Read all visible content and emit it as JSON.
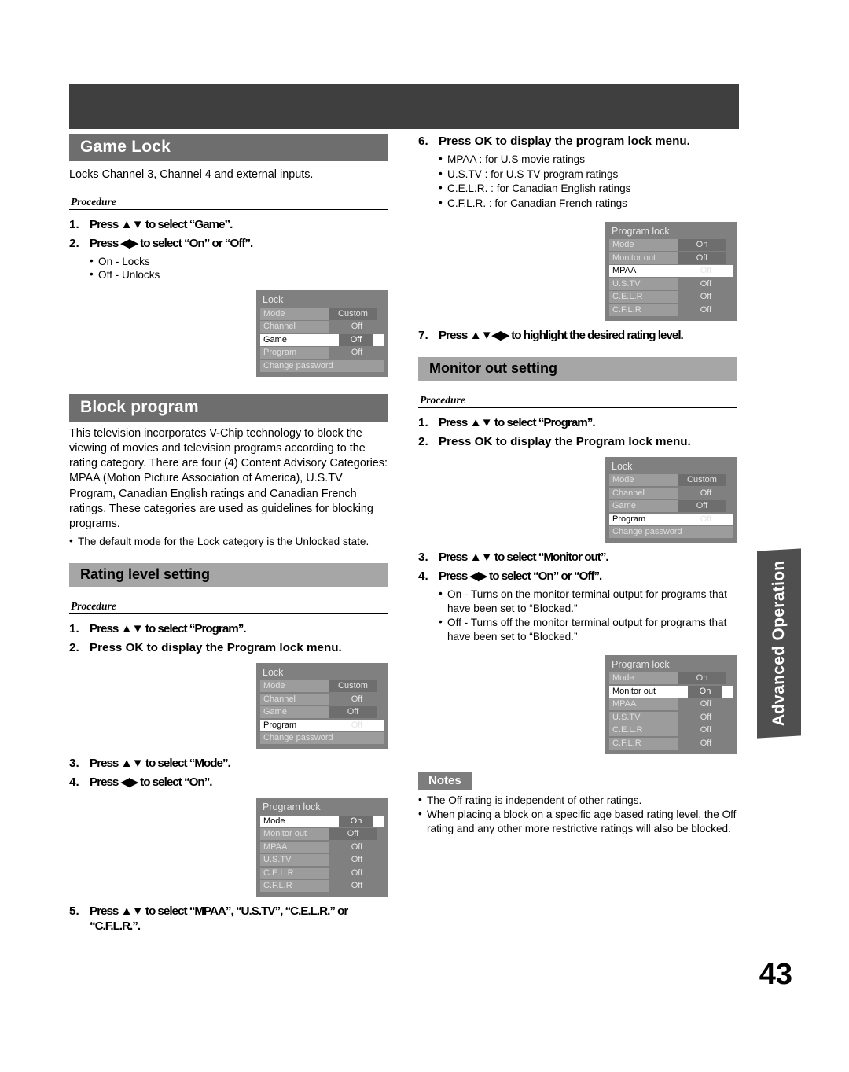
{
  "page": {
    "number": "43",
    "side_tab": "Advanced Operation"
  },
  "game_lock": {
    "heading": "Game Lock",
    "intro": "Locks Channel 3, Channel 4 and external inputs.",
    "procedure_label": "Procedure",
    "steps": [
      {
        "num": "1.",
        "text": "Press ▲▼ to select “Game”."
      },
      {
        "num": "2.",
        "text": "Press ◀▶ to select “On” or “Off”."
      }
    ],
    "bullets": [
      "On - Locks",
      "Off - Unlocks"
    ],
    "osd": {
      "title": "Lock",
      "rows": [
        {
          "label": "Mode",
          "value": "Custom",
          "boxed": true,
          "selected": false
        },
        {
          "label": "Channel",
          "value": "Off",
          "boxed": false,
          "selected": false
        },
        {
          "label": "Game",
          "value": "Off",
          "boxed": true,
          "selected": true
        },
        {
          "label": "Program",
          "value": "Off",
          "boxed": false,
          "selected": false
        },
        {
          "label": "Change password",
          "value": "",
          "boxed": false,
          "selected": false,
          "full": true
        }
      ]
    }
  },
  "block_program": {
    "heading": "Block program",
    "body": "This television incorporates V-Chip technology to block the viewing of movies and television programs according to the rating category. There are four (4) Content Advisory Categories: MPAA (Motion Picture Association of America), U.S.TV Program, Canadian English ratings and Canadian French ratings. These categories are used as guidelines for blocking programs.",
    "bullets": [
      "The default mode for the Lock category is the Unlocked state."
    ]
  },
  "rating_level": {
    "heading": "Rating level setting",
    "procedure_label": "Procedure",
    "steps_a": [
      {
        "num": "1.",
        "text": "Press ▲▼ to select “Program”."
      },
      {
        "num": "2.",
        "text": "Press OK to display the Program lock menu."
      }
    ],
    "osd_lock": {
      "title": "Lock",
      "rows": [
        {
          "label": "Mode",
          "value": "Custom",
          "boxed": true,
          "selected": false
        },
        {
          "label": "Channel",
          "value": "Off",
          "boxed": false,
          "selected": false
        },
        {
          "label": "Game",
          "value": "Off",
          "boxed": true,
          "selected": false
        },
        {
          "label": "Program",
          "value": "Off",
          "boxed": false,
          "selected": true
        },
        {
          "label": "Change password",
          "value": "",
          "boxed": false,
          "selected": false,
          "full": true
        }
      ]
    },
    "steps_b": [
      {
        "num": "3.",
        "text": "Press ▲▼ to select “Mode”."
      },
      {
        "num": "4.",
        "text": "Press ◀▶ to select “On”."
      }
    ],
    "osd_program_lock": {
      "title": "Program lock",
      "rows": [
        {
          "label": "Mode",
          "value": "On",
          "boxed": true,
          "selected": true
        },
        {
          "label": "Monitor out",
          "value": "Off",
          "boxed": true,
          "selected": false
        },
        {
          "label": "MPAA",
          "value": "Off",
          "boxed": false,
          "selected": false
        },
        {
          "label": "U.S.TV",
          "value": "Off",
          "boxed": false,
          "selected": false
        },
        {
          "label": "C.E.L.R",
          "value": "Off",
          "boxed": false,
          "selected": false
        },
        {
          "label": "C.F.L.R",
          "value": "Off",
          "boxed": false,
          "selected": false
        }
      ]
    },
    "steps_c": [
      {
        "num": "5.",
        "text": "Press ▲▼ to select “MPAA”, “U.S.TV”, “C.E.L.R.” or “C.F.L.R.”."
      }
    ],
    "steps_d": [
      {
        "num": "6.",
        "text": "Press OK to display the program lock menu."
      }
    ],
    "step6_bullets": [
      "MPAA : for U.S movie ratings",
      "U.S.TV : for U.S TV program ratings",
      "C.E.L.R. : for Canadian English ratings",
      "C.F.L.R. : for Canadian French ratings"
    ],
    "osd_program_lock_mpaa": {
      "title": "Program lock",
      "rows": [
        {
          "label": "Mode",
          "value": "On",
          "boxed": true,
          "selected": false
        },
        {
          "label": "Monitor out",
          "value": "Off",
          "boxed": true,
          "selected": false
        },
        {
          "label": "MPAA",
          "value": "Off",
          "boxed": false,
          "selected": true,
          "novalueframe": true
        },
        {
          "label": "U.S.TV",
          "value": "Off",
          "boxed": false,
          "selected": false
        },
        {
          "label": "C.E.L.R",
          "value": "Off",
          "boxed": false,
          "selected": false
        },
        {
          "label": "C.F.L.R",
          "value": "Off",
          "boxed": false,
          "selected": false
        }
      ]
    },
    "steps_e": [
      {
        "num": "7.",
        "text": "Press ▲▼◀▶ to highlight the desired rating level."
      }
    ]
  },
  "monitor_out": {
    "heading": "Monitor out setting",
    "procedure_label": "Procedure",
    "steps_a": [
      {
        "num": "1.",
        "text": "Press ▲▼ to select “Program”."
      },
      {
        "num": "2.",
        "text": "Press OK to display the Program lock menu."
      }
    ],
    "osd_lock": {
      "title": "Lock",
      "rows": [
        {
          "label": "Mode",
          "value": "Custom",
          "boxed": true,
          "selected": false
        },
        {
          "label": "Channel",
          "value": "Off",
          "boxed": false,
          "selected": false
        },
        {
          "label": "Game",
          "value": "Off",
          "boxed": true,
          "selected": false
        },
        {
          "label": "Program",
          "value": "Off",
          "boxed": false,
          "selected": true
        },
        {
          "label": "Change password",
          "value": "",
          "boxed": false,
          "selected": false,
          "full": true
        }
      ]
    },
    "steps_b": [
      {
        "num": "3.",
        "text": "Press ▲▼ to select “Monitor out”."
      },
      {
        "num": "4.",
        "text": "Press ◀▶ to select “On” or “Off”."
      }
    ],
    "bullets": [
      "On - Turns on the monitor terminal output for programs that have been set to “Blocked.”",
      "Off - Turns off the monitor terminal output for programs that have been set to “Blocked.”"
    ],
    "osd_program_lock": {
      "title": "Program lock",
      "rows": [
        {
          "label": "Mode",
          "value": "On",
          "boxed": true,
          "selected": false
        },
        {
          "label": "Monitor out",
          "value": "On",
          "boxed": true,
          "selected": true
        },
        {
          "label": "MPAA",
          "value": "Off",
          "boxed": false,
          "selected": false
        },
        {
          "label": "U.S.TV",
          "value": "Off",
          "boxed": false,
          "selected": false
        },
        {
          "label": "C.E.L.R",
          "value": "Off",
          "boxed": false,
          "selected": false
        },
        {
          "label": "C.F.L.R",
          "value": "Off",
          "boxed": false,
          "selected": false
        }
      ]
    }
  },
  "notes": {
    "label": "Notes",
    "items": [
      "The Off rating is independent of other ratings.",
      "When placing a block on a specific age based rating level, the Off rating and any other more restrictive ratings will also be blocked."
    ]
  },
  "colors": {
    "banner_dark": "#3f3f3f",
    "heading_dark": "#6e6e6e",
    "heading_light": "#a6a6a6",
    "osd_bg": "#808080",
    "osd_label": "#9c9c9c",
    "side_tab": "#4f4f4f"
  }
}
